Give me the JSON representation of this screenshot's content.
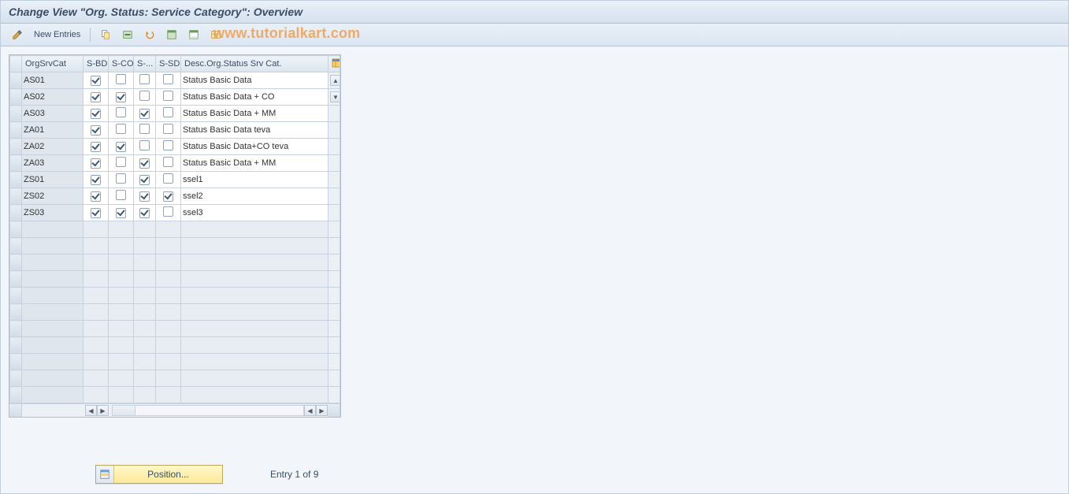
{
  "header": {
    "title": "Change View \"Org. Status: Service Category\": Overview"
  },
  "toolbar": {
    "new_entries_label": "New Entries"
  },
  "watermark": "www.tutorialkart.com",
  "table": {
    "columns": {
      "org": "OrgSrvCat",
      "sbd": "S-BD",
      "sco": "S-CO",
      "smm": "S-...",
      "ssd": "S-SD",
      "desc": "Desc.Org.Status Srv Cat."
    },
    "rows": [
      {
        "org": "AS01",
        "sbd": true,
        "sco": false,
        "smm": false,
        "ssd": false,
        "desc": "Status Basic Data"
      },
      {
        "org": "AS02",
        "sbd": true,
        "sco": true,
        "smm": false,
        "ssd": false,
        "desc": "Status Basic Data + CO"
      },
      {
        "org": "AS03",
        "sbd": true,
        "sco": false,
        "smm": true,
        "ssd": false,
        "desc": "Status Basic Data + MM"
      },
      {
        "org": "ZA01",
        "sbd": true,
        "sco": false,
        "smm": false,
        "ssd": false,
        "desc": "Status Basic Data teva"
      },
      {
        "org": "ZA02",
        "sbd": true,
        "sco": true,
        "smm": false,
        "ssd": false,
        "desc": "Status Basic Data+CO teva"
      },
      {
        "org": "ZA03",
        "sbd": true,
        "sco": false,
        "smm": true,
        "ssd": false,
        "desc": "Status Basic Data + MM"
      },
      {
        "org": "ZS01",
        "sbd": true,
        "sco": false,
        "smm": true,
        "ssd": false,
        "desc": "ssel1"
      },
      {
        "org": "ZS02",
        "sbd": true,
        "sco": false,
        "smm": true,
        "ssd": true,
        "desc": "ssel2"
      },
      {
        "org": "ZS03",
        "sbd": true,
        "sco": true,
        "smm": true,
        "ssd": false,
        "desc": "ssel3"
      }
    ],
    "empty_rows": 11
  },
  "footer": {
    "position_label": "Position...",
    "entry_label": "Entry 1 of 9"
  }
}
